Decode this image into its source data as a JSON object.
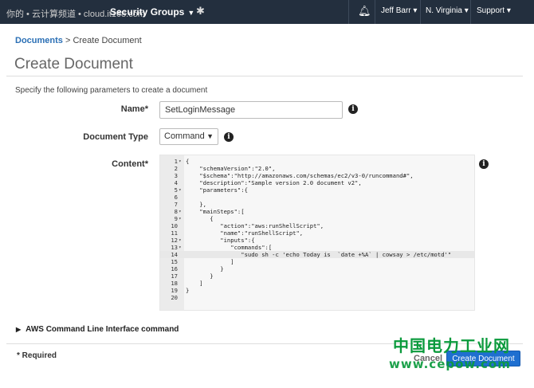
{
  "topbar": {
    "watermark_text": "你的 • 云计算频道 • cloud.it168.com",
    "menu_label": "Security Groups",
    "user": "Jeff Barr",
    "region": "N. Virginia",
    "support": "Support"
  },
  "breadcrumb": {
    "root": "Documents",
    "separator": " > ",
    "current": "Create Document"
  },
  "page": {
    "title": "Create Document",
    "intro": "Specify the following parameters to create a document"
  },
  "form": {
    "name_label": "Name*",
    "name_value": "SetLoginMessage",
    "type_label": "Document Type",
    "type_value": "Command",
    "content_label": "Content*"
  },
  "editor": {
    "lines": [
      {
        "n": "1",
        "fold": "▾",
        "text": "{"
      },
      {
        "n": "2",
        "fold": "",
        "text": "    \"schemaVersion\":\"2.0\","
      },
      {
        "n": "3",
        "fold": "",
        "text": "    \"$schema\":\"http://amazonaws.com/schemas/ec2/v3-0/runcommand#\","
      },
      {
        "n": "4",
        "fold": "",
        "text": "    \"description\":\"Sample version 2.0 document v2\","
      },
      {
        "n": "5",
        "fold": "▾",
        "text": "    \"parameters\":{"
      },
      {
        "n": "6",
        "fold": "",
        "text": ""
      },
      {
        "n": "7",
        "fold": "",
        "text": "    },"
      },
      {
        "n": "8",
        "fold": "▾",
        "text": "    \"mainSteps\":["
      },
      {
        "n": "9",
        "fold": "▾",
        "text": "       {"
      },
      {
        "n": "10",
        "fold": "",
        "text": "          \"action\":\"aws:runShellScript\","
      },
      {
        "n": "11",
        "fold": "",
        "text": "          \"name\":\"runShellScript\","
      },
      {
        "n": "12",
        "fold": "▾",
        "text": "          \"inputs\":{"
      },
      {
        "n": "13",
        "fold": "▾",
        "text": "             \"commands\":["
      },
      {
        "n": "14",
        "fold": "",
        "text": "                \"sudo sh -c 'echo Today is  `date +%A` | cowsay > /etc/motd'\""
      },
      {
        "n": "15",
        "fold": "",
        "text": "             ]"
      },
      {
        "n": "16",
        "fold": "",
        "text": "          }"
      },
      {
        "n": "17",
        "fold": "",
        "text": "       }"
      },
      {
        "n": "18",
        "fold": "",
        "text": "    ]"
      },
      {
        "n": "19",
        "fold": "",
        "text": "}"
      },
      {
        "n": "20",
        "fold": "",
        "text": ""
      }
    ],
    "active_line": 14
  },
  "cli_section": "AWS Command Line Interface command",
  "required_note": "* Required",
  "buttons": {
    "cancel": "Cancel",
    "create": "Create Document"
  },
  "watermark": {
    "line1": "中国电力工业网",
    "line2": "www.cepow.com"
  },
  "icons": {
    "info": "info-icon",
    "bell": "bell-icon",
    "pin": "pin-icon"
  },
  "colors": {
    "topbar": "#232f3e",
    "link": "#2a6fb5",
    "primary": "#1f6fd0",
    "watermark": "#0a9a3c"
  }
}
